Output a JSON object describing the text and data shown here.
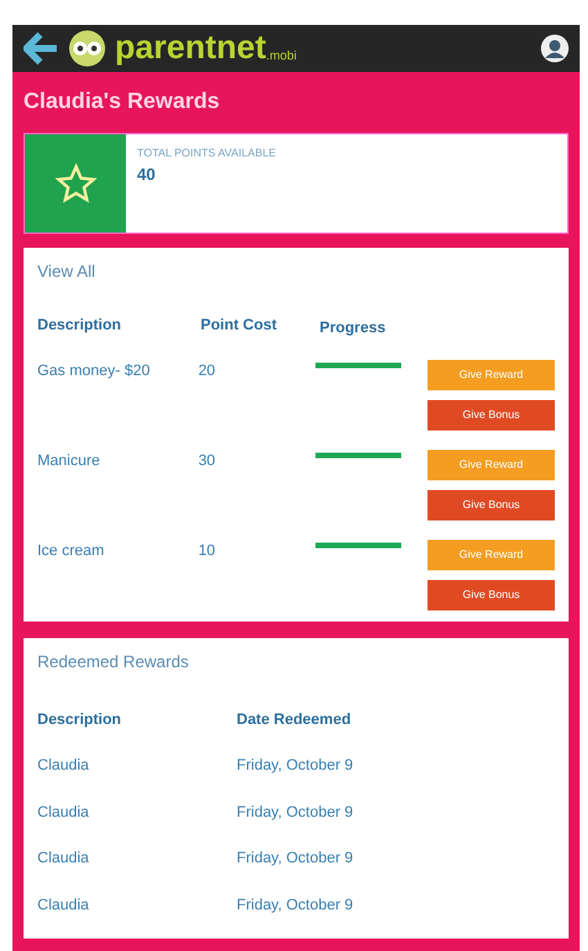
{
  "header": {
    "logo_text": "parentnet",
    "logo_suffix": ".mobi"
  },
  "page_title": "Claudia's Rewards",
  "points": {
    "label": "TOTAL POINTS AVAILABLE",
    "value": "40"
  },
  "rewards": {
    "title": "View All",
    "columns": [
      "Description",
      "Point Cost",
      "Progress"
    ],
    "rows": [
      {
        "description": "Gas money- $20",
        "cost": "20",
        "level": 1,
        "buttons": [
          "Give Reward",
          "Give Bonus"
        ]
      },
      {
        "description": "Manicure",
        "cost": "30",
        "level": 1,
        "buttons": [
          "Give Reward",
          "Give Bonus"
        ]
      },
      {
        "description": "Ice cream",
        "cost": "10",
        "level": 1,
        "buttons": [
          "Give Reward",
          "Give Bonus"
        ]
      }
    ]
  },
  "redeemed": {
    "title": "Redeemed Rewards",
    "columns": [
      "Description",
      "Date Redeemed"
    ],
    "rows": [
      {
        "description": "Claudia",
        "date": "Friday, October 9"
      },
      {
        "description": "Claudia",
        "date": "Friday, October 9"
      },
      {
        "description": "Claudia",
        "date": "Friday, October 9"
      },
      {
        "description": "Claudia",
        "date": "Friday, October 9"
      }
    ]
  }
}
